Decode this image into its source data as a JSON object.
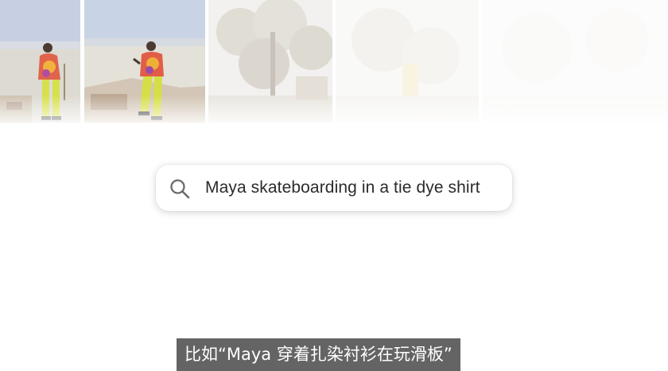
{
  "search": {
    "query": "Maya skateboarding in a tie dye shirt",
    "icon": "search-icon"
  },
  "subtitle": {
    "text": "比如“Maya 穿着扎染衬衫在玩滑板”"
  },
  "photos": [
    {
      "name": "photo-skateboard-1"
    },
    {
      "name": "photo-skateboard-2"
    },
    {
      "name": "photo-trees"
    },
    {
      "name": "photo-faded-1"
    },
    {
      "name": "photo-faded-2"
    }
  ],
  "colors": {
    "background": "#ffffff",
    "search_text": "#2b2b2b",
    "subtitle_bg": "#3a3a3a",
    "subtitle_text": "#ffffff"
  }
}
